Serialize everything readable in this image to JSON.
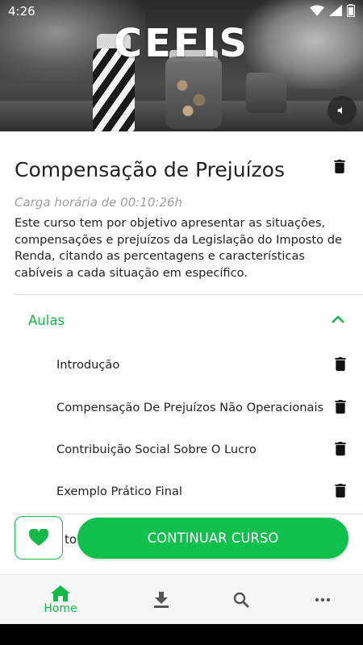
{
  "status_bar": {
    "time": "4:26"
  },
  "hero": {
    "brand_title": "CEFIS",
    "mute_icon": "volume-mute-icon"
  },
  "course": {
    "title": "Compensação de Prejuízos",
    "workload": "Carga horária de 00:10:26h",
    "description": "Este curso tem por objetivo apresentar as situações, compensações e prejuízos da Legislação do Imposto de Renda, citando as percentagens e características cabíveis a cada situação em específico."
  },
  "lessons_section": {
    "label": "Aulas",
    "expanded": true,
    "items": [
      {
        "label": "Introdução"
      },
      {
        "label": "Compensação De Prejuízos Não Operacionais"
      },
      {
        "label": "Contribuição Social Sobre O Lucro"
      },
      {
        "label": "Exemplo Prático Final"
      }
    ]
  },
  "actions": {
    "obscured_text": "to",
    "continue_label": "CONTINUAR CURSO",
    "favorite_icon": "heart-icon"
  },
  "bottom_nav": {
    "items": [
      {
        "label": "Home",
        "icon": "home-icon",
        "active": true
      },
      {
        "label": "",
        "icon": "download-icon",
        "active": false
      },
      {
        "label": "",
        "icon": "search-icon",
        "active": false
      },
      {
        "label": "",
        "icon": "more-icon",
        "active": false
      }
    ]
  },
  "colors": {
    "accent": "#16b84a",
    "button": "#0fc14c",
    "text": "#222222",
    "muted": "#9e9e9e"
  }
}
